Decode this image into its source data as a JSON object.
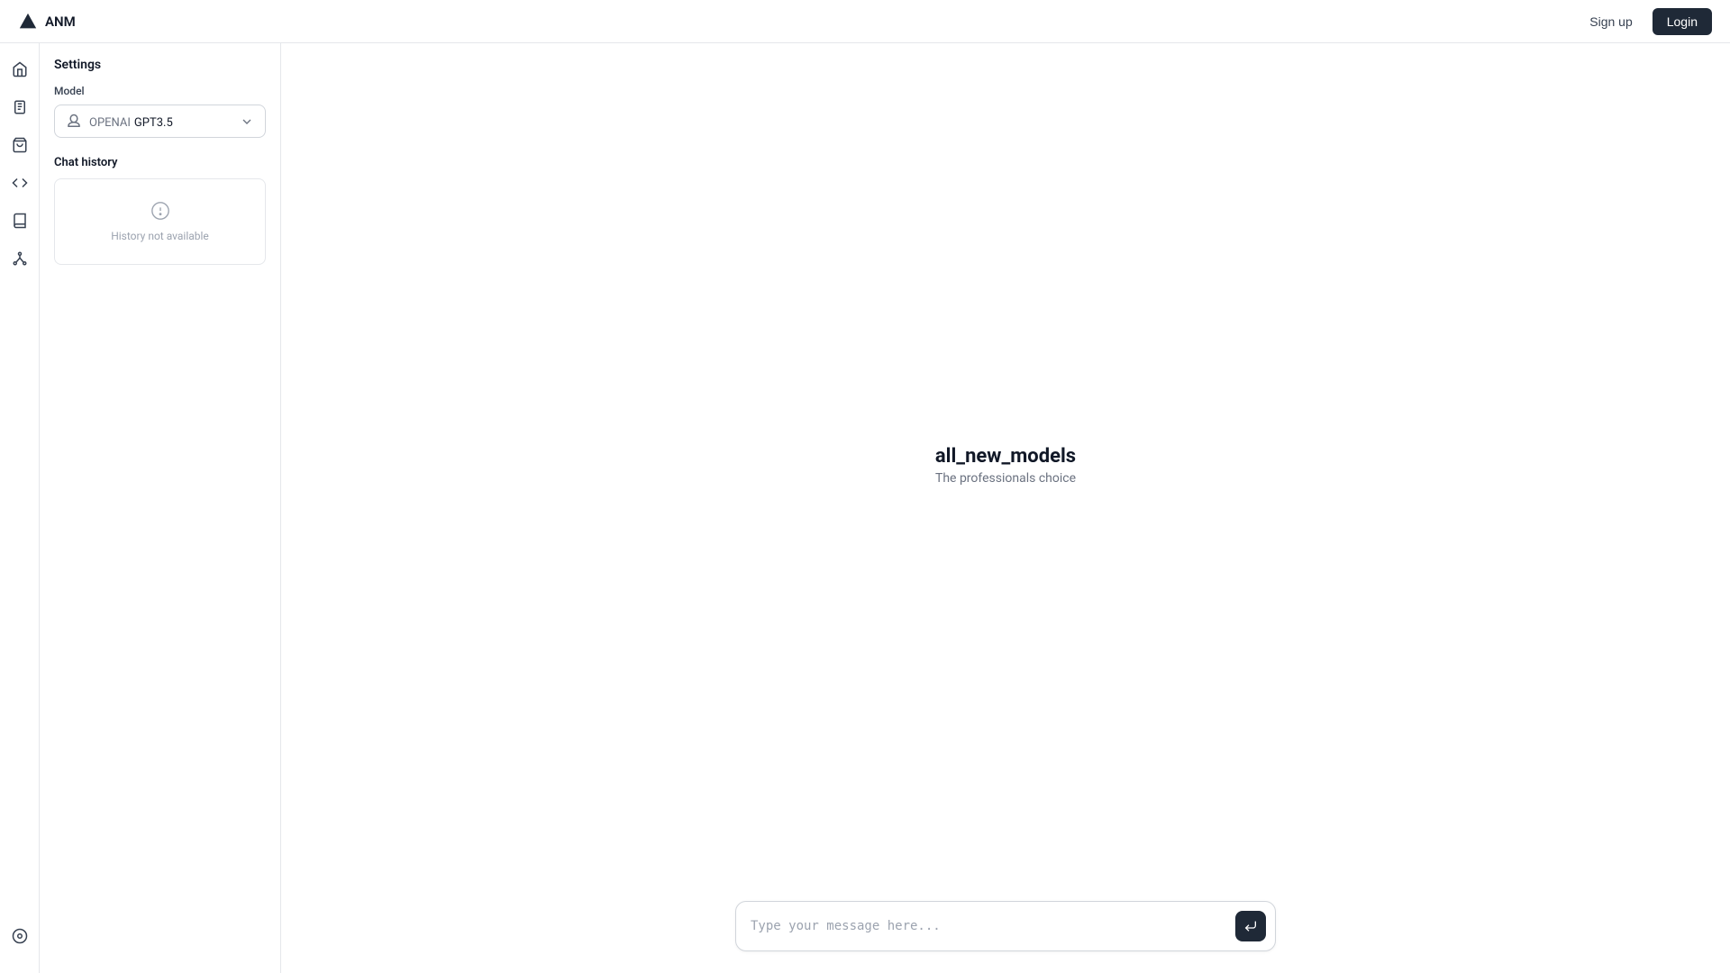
{
  "header": {
    "title": "ANM",
    "signup_label": "Sign up",
    "login_label": "Login"
  },
  "sidebar": {
    "icons": [
      {
        "name": "home-icon",
        "label": "Home"
      },
      {
        "name": "document-icon",
        "label": "Documents"
      },
      {
        "name": "bag-icon",
        "label": "Bag"
      },
      {
        "name": "code-icon",
        "label": "Code"
      },
      {
        "name": "book-icon",
        "label": "Book"
      },
      {
        "name": "network-icon",
        "label": "Network"
      }
    ],
    "bottom_icons": [
      {
        "name": "settings-circle-icon",
        "label": "Settings"
      }
    ]
  },
  "settings": {
    "title": "Settings",
    "model_section": "Model",
    "model_prefix": "OPENAI",
    "model_name": "GPT3.5",
    "chat_history_title": "Chat history",
    "history_empty_text": "History not available"
  },
  "chat": {
    "branding_title": "all_new_models",
    "branding_subtitle": "The professionals choice",
    "input_placeholder": "Type your message here..."
  }
}
